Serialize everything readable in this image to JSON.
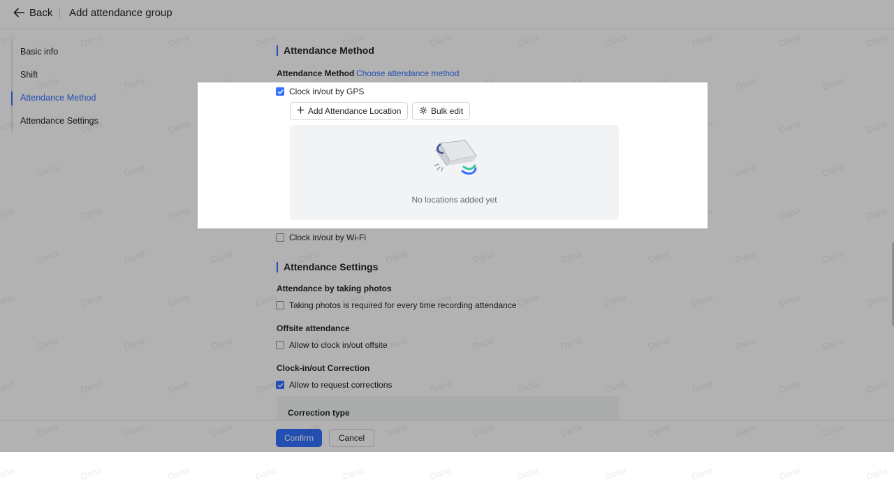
{
  "header": {
    "back_label": "Back",
    "title": "Add attendance group"
  },
  "nav": {
    "items": [
      {
        "label": "Basic info"
      },
      {
        "label": "Shift"
      },
      {
        "label": "Attendance Method",
        "active": true
      },
      {
        "label": "Attendance Settings"
      }
    ]
  },
  "method_section": {
    "title": "Attendance Method",
    "field_label": "Attendance Method",
    "choose_link": "Choose attendance method",
    "gps": {
      "label": "Clock in/out by GPS",
      "checked": true
    },
    "add_location_label": "Add Attendance Location",
    "bulk_edit_label": "Bulk edit",
    "empty_text": "No locations added yet",
    "wifi": {
      "label": "Clock in/out by Wi-Fi",
      "checked": false
    }
  },
  "settings_section": {
    "title": "Attendance Settings",
    "photos": {
      "label": "Attendance by taking photos",
      "option": "Taking photos is required for every time recording attendance",
      "checked": false
    },
    "offsite": {
      "label": "Offsite attendance",
      "option": "Allow to clock in/out offsite",
      "checked": false
    },
    "correction": {
      "label": "Clock-in/out Correction",
      "option": "Allow to request corrections",
      "checked": true,
      "type_label": "Correction type"
    }
  },
  "footer": {
    "confirm_label": "Confirm",
    "cancel_label": "Cancel"
  },
  "watermark": "Dana",
  "colors": {
    "accent": "#3370ff",
    "text": "#1f2329",
    "muted": "#646a73",
    "panel": "#f2f3f5"
  }
}
